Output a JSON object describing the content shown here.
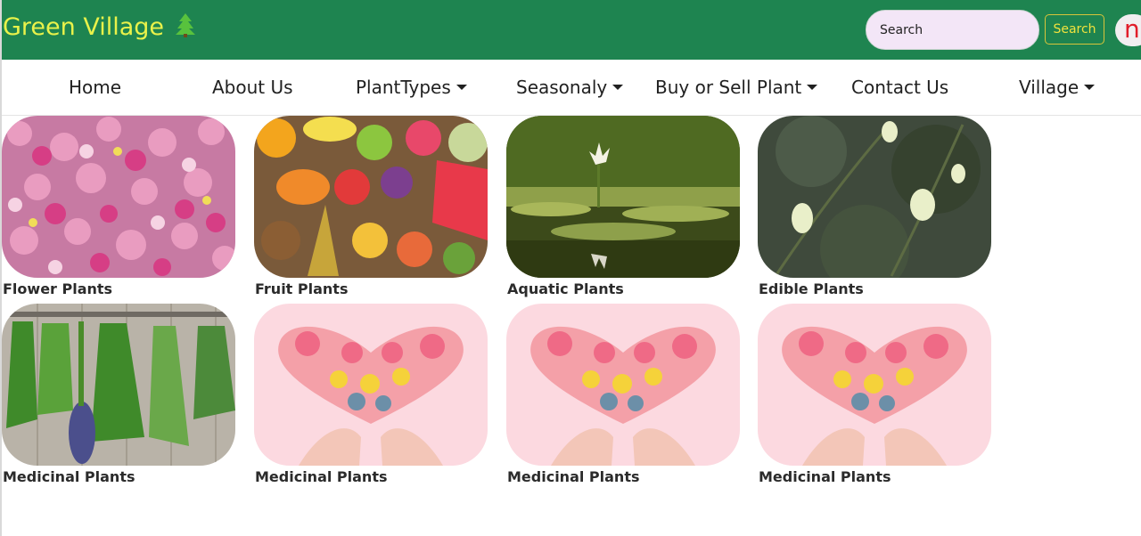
{
  "brand": {
    "title": "Green Village",
    "icon": "pine-tree-icon"
  },
  "search": {
    "placeholder": "Search",
    "button_label": "Search"
  },
  "user": {
    "avatar_initial": "n"
  },
  "nav": {
    "items": [
      {
        "label": "Home",
        "dropdown": false
      },
      {
        "label": "About Us",
        "dropdown": false
      },
      {
        "label": "PlantTypes",
        "dropdown": true
      },
      {
        "label": "Seasonaly",
        "dropdown": true
      },
      {
        "label": "Buy or Sell Plant",
        "dropdown": true
      },
      {
        "label": "Contact Us",
        "dropdown": false
      },
      {
        "label": "Village",
        "dropdown": true
      }
    ]
  },
  "categories": [
    {
      "label": "Flower Plants",
      "image": "flower-wall-photo"
    },
    {
      "label": "Fruit Plants",
      "image": "fruit-assortment-photo"
    },
    {
      "label": "Aquatic Plants",
      "image": "water-lily-pond-photo"
    },
    {
      "label": "Edible Plants",
      "image": "white-flower-shrub-photo"
    },
    {
      "label": "Medicinal Plants",
      "image": "hanging-herbs-photo"
    },
    {
      "label": "Medicinal Plants",
      "image": "flower-heart-hands-photo"
    },
    {
      "label": "Medicinal Plants",
      "image": "flower-heart-hands-photo"
    },
    {
      "label": "Medicinal Plants",
      "image": "flower-heart-hands-photo"
    }
  ],
  "colors": {
    "header": "#1e8450",
    "brand_text": "#e9f24a",
    "search_button": "#f0e23d",
    "avatar_letter": "#e11d2a"
  }
}
